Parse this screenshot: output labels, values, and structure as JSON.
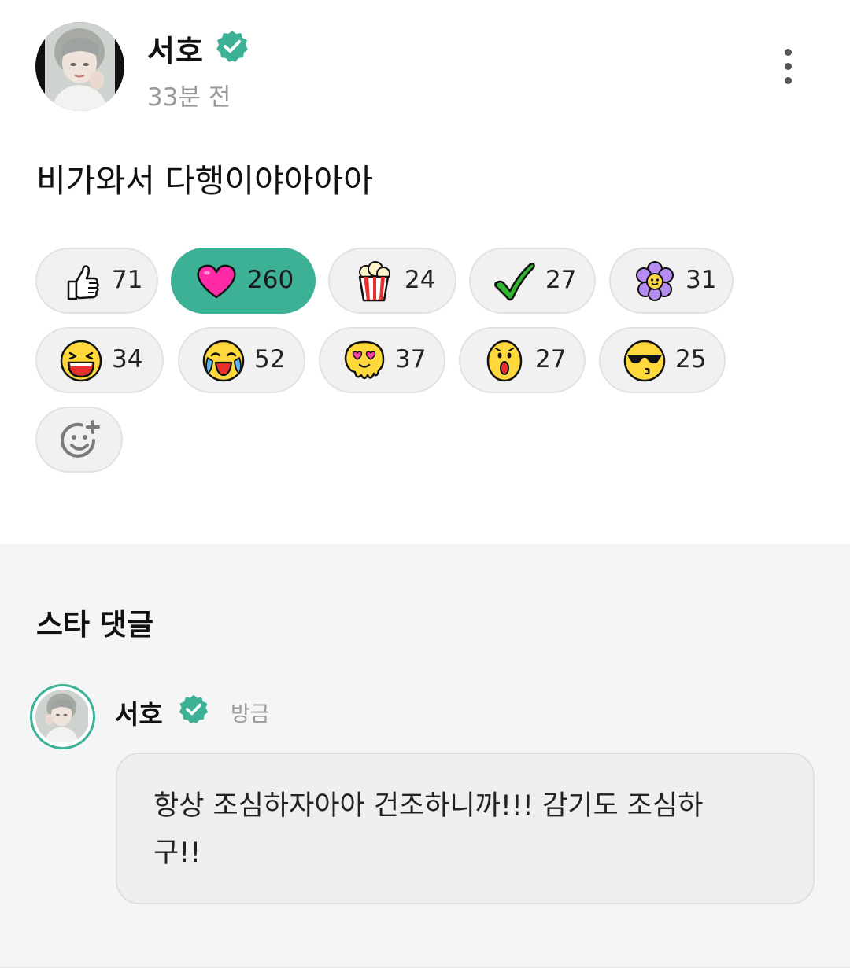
{
  "post": {
    "author": "서호",
    "time": "33분 전",
    "text": "비가와서 다행이야아아아"
  },
  "reactions": [
    {
      "icon": "thumbs-up-icon",
      "count": "71"
    },
    {
      "icon": "heart-icon",
      "count": "260",
      "active": true
    },
    {
      "icon": "popcorn-icon",
      "count": "24"
    },
    {
      "icon": "checkmark-icon",
      "count": "27"
    },
    {
      "icon": "flower-icon",
      "count": "31"
    },
    {
      "icon": "laughing-face-icon",
      "count": "34"
    },
    {
      "icon": "crying-laughing-face-icon",
      "count": "52"
    },
    {
      "icon": "heart-eyes-melting-face-icon",
      "count": "37"
    },
    {
      "icon": "surprised-face-icon",
      "count": "27"
    },
    {
      "icon": "sunglasses-kiss-face-icon",
      "count": "25"
    }
  ],
  "add_reaction_icon": "add-emoji-icon",
  "comments_section": {
    "title": "스타 댓글",
    "comment": {
      "author": "서호",
      "time": "방금",
      "text_line1": "항상 조심하자아아 건조하니까!!! 감기도 조심하",
      "text_line2": "구!!"
    }
  },
  "colors": {
    "accent": "#3db196",
    "time_gray": "#9a9a9a",
    "comments_bg": "#f5f5f5",
    "chip_bg": "#f1f1f1"
  }
}
